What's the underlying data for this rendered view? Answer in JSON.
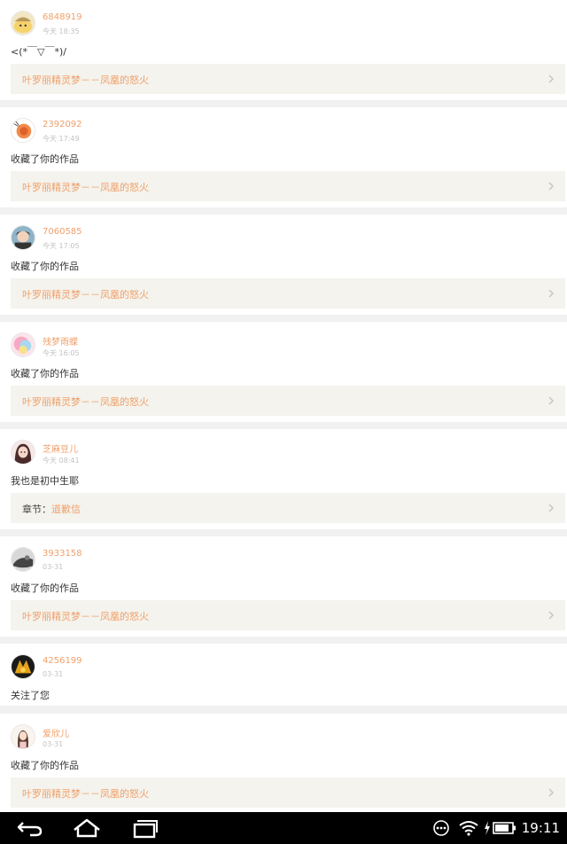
{
  "notifications": [
    {
      "user": "6848919",
      "time": "今天 18:35",
      "message": "<(*￣▽￣*)/",
      "ref_prefix": "",
      "ref_title": "叶罗丽精灵梦－－凤凰的怒火"
    },
    {
      "user": "2392092",
      "time": "今天 17:49",
      "message": "收藏了你的作品",
      "ref_prefix": "",
      "ref_title": "叶罗丽精灵梦－－凤凰的怒火"
    },
    {
      "user": "7060585",
      "time": "今天 17:05",
      "message": "收藏了你的作品",
      "ref_prefix": "",
      "ref_title": "叶罗丽精灵梦－－凤凰的怒火"
    },
    {
      "user": "残梦雨蝶",
      "time": "今天 16:05",
      "message": "收藏了你的作品",
      "ref_prefix": "",
      "ref_title": "叶罗丽精灵梦－－凤凰的怒火"
    },
    {
      "user": "芝麻豆儿",
      "time": "今天 08:41",
      "message": "我也是初中生耶",
      "ref_prefix": "章节：",
      "ref_title": "道歉信"
    },
    {
      "user": "3933158",
      "time": "03-31",
      "message": "收藏了你的作品",
      "ref_prefix": "",
      "ref_title": "叶罗丽精灵梦－－凤凰的怒火"
    },
    {
      "user": "4256199",
      "time": "03-31",
      "message": "关注了您",
      "ref_prefix": "",
      "ref_title": ""
    },
    {
      "user": "爱欣儿",
      "time": "03-31",
      "message": "收藏了你的作品",
      "ref_prefix": "",
      "ref_title": "叶罗丽精灵梦－－凤凰的怒火"
    }
  ],
  "status_bar": {
    "clock": "19:11",
    "icons": [
      "more-icon",
      "wifi-icon",
      "charging-icon",
      "battery-icon"
    ]
  },
  "nav_bar": {
    "buttons": [
      "back-icon",
      "home-icon",
      "recent-apps-icon"
    ]
  },
  "colors": {
    "accent": "#f0a06a",
    "ref_background": "#f4f3ed",
    "separator": "#f1f1f1"
  }
}
